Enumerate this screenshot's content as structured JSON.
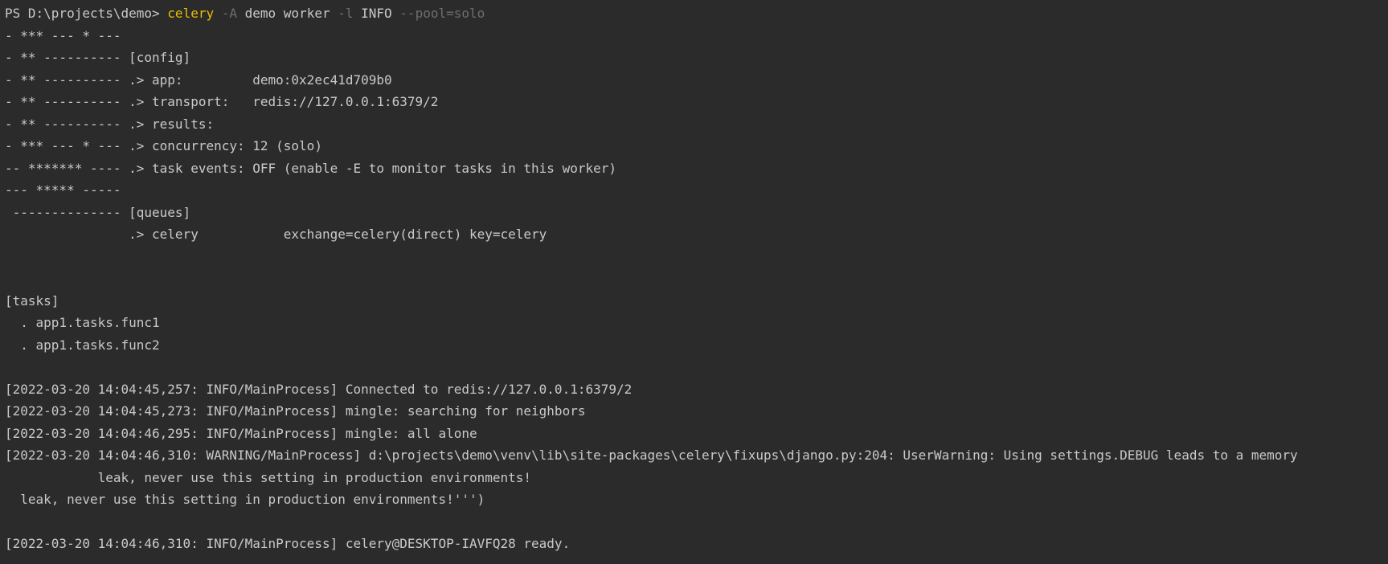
{
  "prompt": {
    "ps": "PS D:\\projects\\demo> ",
    "cmd": "celery",
    "flag_a": "-A",
    "app": " demo worker ",
    "flag_l": "-l",
    "level": " INFO ",
    "pool": "--pool=solo"
  },
  "lines": [
    "- *** --- * ---",
    "- ** ---------- [config]",
    "- ** ---------- .> app:         demo:0x2ec41d709b0",
    "- ** ---------- .> transport:   redis://127.0.0.1:6379/2",
    "- ** ---------- .> results:",
    "- *** --- * --- .> concurrency: 12 (solo)",
    "-- ******* ---- .> task events: OFF (enable -E to monitor tasks in this worker)",
    "--- ***** -----",
    " -------------- [queues]",
    "                .> celery           exchange=celery(direct) key=celery",
    "",
    "",
    "[tasks]",
    "  . app1.tasks.func1",
    "  . app1.tasks.func2",
    "",
    "[2022-03-20 14:04:45,257: INFO/MainProcess] Connected to redis://127.0.0.1:6379/2",
    "[2022-03-20 14:04:45,273: INFO/MainProcess] mingle: searching for neighbors",
    "[2022-03-20 14:04:46,295: INFO/MainProcess] mingle: all alone",
    "[2022-03-20 14:04:46,310: WARNING/MainProcess] d:\\projects\\demo\\venv\\lib\\site-packages\\celery\\fixups\\django.py:204: UserWarning: Using settings.DEBUG leads to a memory",
    "            leak, never use this setting in production environments!",
    "  leak, never use this setting in production environments!''')",
    "",
    "[2022-03-20 14:04:46,310: INFO/MainProcess] celery@DESKTOP-IAVFQ28 ready."
  ],
  "colors": {
    "background": "#2b2b2b",
    "text": "#c9c9c9",
    "command": "#e8bf00",
    "dimmed": "#6e6e6e"
  }
}
